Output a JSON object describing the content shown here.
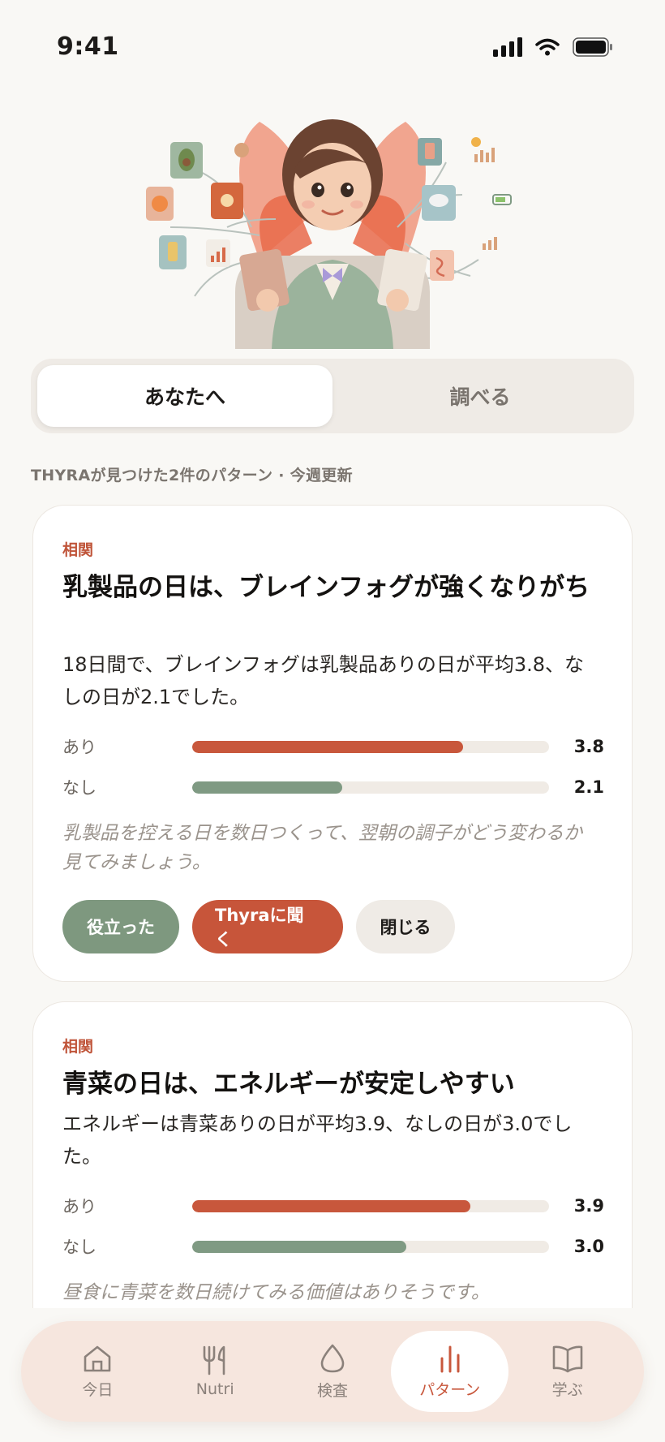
{
  "status_bar": {
    "time": "9:41"
  },
  "segment": {
    "tabs": [
      {
        "label": "あなたへ",
        "active": true
      },
      {
        "label": "調べる",
        "active": false
      }
    ]
  },
  "section_label": "THYRAが見つけた2件のパターン · 今週更新",
  "cards": [
    {
      "tag": "相関",
      "title": "乳製品の日は、ブレインフォグが強くなりがち",
      "body": "18日間で、ブレインフォグは乳製品ありの日が平均3.8、なしの日が2.1でした。",
      "bars": [
        {
          "label": "あり",
          "value": "3.8",
          "fill": 0.76
        },
        {
          "label": "なし",
          "value": "2.1",
          "fill": 0.42
        }
      ],
      "hint": "乳製品を控える日を数日つくって、翌朝の調子がどう変わるか見てみましょう。",
      "actions": {
        "helpful": "役立った",
        "ask": "Thyraに聞く",
        "close": "閉じる"
      }
    },
    {
      "tag": "相関",
      "title": "青菜の日は、エネルギーが安定しやすい",
      "body": "エネルギーは青菜ありの日が平均3.9、なしの日が3.0でした。",
      "bars": [
        {
          "label": "あり",
          "value": "3.9",
          "fill": 0.78
        },
        {
          "label": "なし",
          "value": "3.0",
          "fill": 0.6
        }
      ],
      "hint": "昼食に青菜を数日続けてみる価値はありそうです。"
    }
  ],
  "tabbar": {
    "items": [
      {
        "label": "今日",
        "icon": "home-icon"
      },
      {
        "label": "Nutri",
        "icon": "fork-knife-icon"
      },
      {
        "label": "検査",
        "icon": "drop-icon"
      },
      {
        "label": "パターン",
        "icon": "bar-chart-icon",
        "active": true
      },
      {
        "label": "学ぶ",
        "icon": "book-icon"
      }
    ]
  },
  "colors": {
    "accent": "#c8573c",
    "green": "#7f9a83",
    "background": "#f9f8f5"
  }
}
